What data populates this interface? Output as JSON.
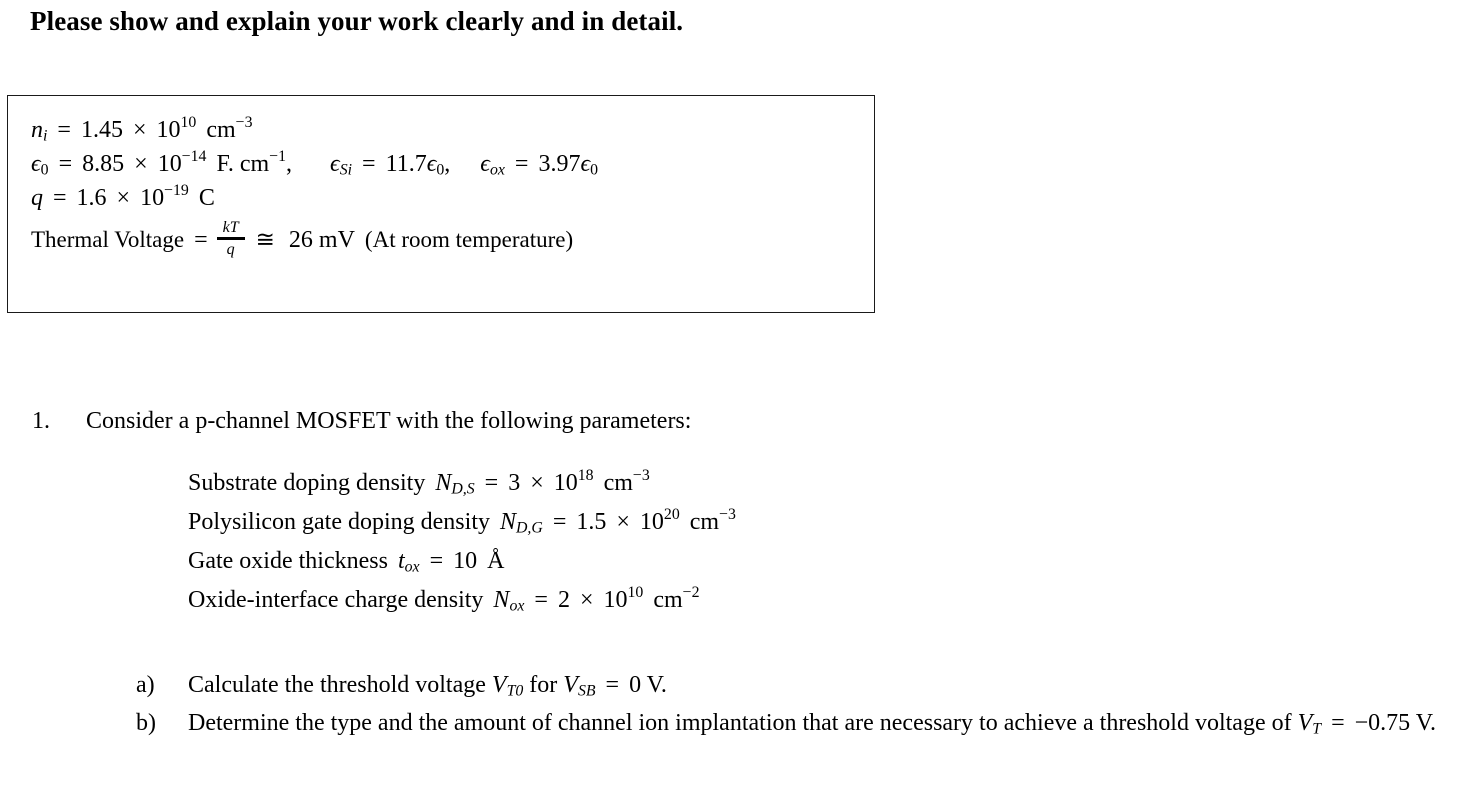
{
  "document": {
    "heading": "Please show and explain your work clearly and in detail.",
    "constants_box": {
      "line_ni": {
        "symbol": "n",
        "symbol_sub": "i",
        "equals": "=",
        "mantissa": "1.45",
        "times": "×",
        "base": "10",
        "exponent": "10",
        "unit": "cm",
        "unit_exponent": "−3"
      },
      "line_eps0": {
        "symbol": "ϵ",
        "symbol_sub": "0",
        "equals": "=",
        "mantissa": "8.85",
        "times": "×",
        "base": "10",
        "exponent": "−14",
        "unit": "F. cm",
        "unit_exponent": "−1",
        "comma": ",",
        "eps_si_symbol": "ϵ",
        "eps_si_sub": "Si",
        "eps_si_equals": "=",
        "eps_si_value": "11.7",
        "eps_si_unit": "ϵ",
        "eps_si_unit_sub": "0",
        "eps_si_comma": ",",
        "eps_ox_symbol": "ϵ",
        "eps_ox_sub": "ox",
        "eps_ox_equals": "=",
        "eps_ox_value": "3.97",
        "eps_ox_unit": "ϵ",
        "eps_ox_unit_sub": "0"
      },
      "line_q": {
        "symbol": "q",
        "equals": "=",
        "mantissa": "1.6",
        "times": "×",
        "base": "10",
        "exponent": "−19",
        "unit": "C"
      },
      "line_thermal": {
        "label": "Thermal Voltage",
        "equals": "=",
        "fraction_numerator": "kT",
        "fraction_denominator": "q",
        "approx_symbol": "≅",
        "value": "26 mV",
        "note": "(At room temperature)"
      }
    },
    "question": {
      "number": "1.",
      "stem": "Consider a p-channel MOSFET with the following parameters:",
      "parameters": [
        {
          "label": "Substrate doping density",
          "symbol": "N",
          "symbol_sub": "D,S",
          "equals": "=",
          "mantissa": "3",
          "times": "×",
          "base": "10",
          "exponent": "18",
          "unit": "cm",
          "unit_exponent": "−3"
        },
        {
          "label": "Polysilicon gate doping density",
          "symbol": "N",
          "symbol_sub": "D,G",
          "equals": "=",
          "mantissa": "1.5",
          "times": "×",
          "base": "10",
          "exponent": "20",
          "unit": "cm",
          "unit_exponent": "−3"
        },
        {
          "label": "Gate oxide thickness",
          "symbol": "t",
          "symbol_sub": "ox",
          "equals": "=",
          "mantissa": "10",
          "times": "",
          "base": "",
          "exponent": "",
          "unit": "Å",
          "unit_exponent": ""
        },
        {
          "label": "Oxide-interface charge density",
          "symbol": "N",
          "symbol_sub": "ox",
          "equals": "=",
          "mantissa": "2",
          "times": "×",
          "base": "10",
          "exponent": "10",
          "unit": "cm",
          "unit_exponent": "−2"
        }
      ],
      "sub_items": [
        {
          "marker": "a)",
          "text_before": "Calculate the threshold voltage",
          "symbol_1": "V",
          "symbol_1_sub": "T0",
          "text_middle": "for",
          "symbol_2": "V",
          "symbol_2_sub": "SB",
          "equals": "=",
          "text_after": "0 V."
        },
        {
          "marker": "b)",
          "text_before": "Determine the type and the amount of channel ion implantation that are necessary to achieve a threshold voltage of",
          "symbol_1": "V",
          "symbol_1_sub": "T",
          "equals": "=",
          "text_after": "−0.75 V."
        }
      ]
    }
  }
}
